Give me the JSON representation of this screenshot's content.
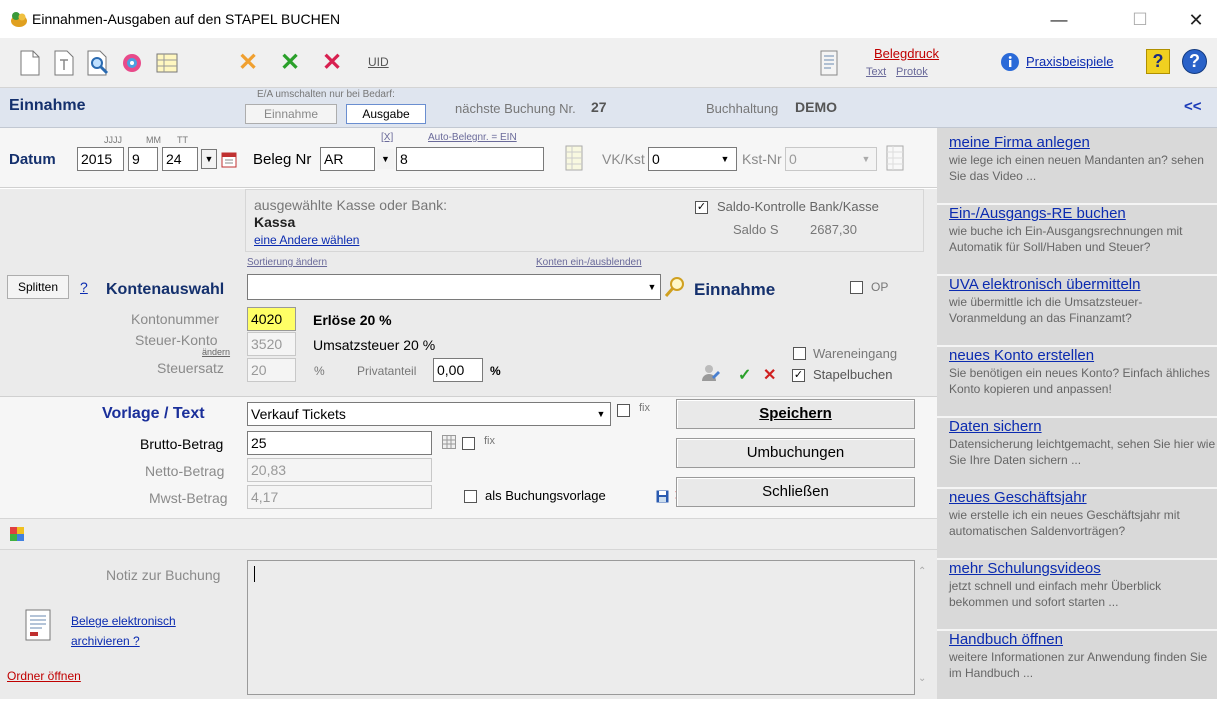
{
  "window": {
    "title": "Einnahmen-Ausgaben auf den STAPEL BUCHEN",
    "minimize": "—",
    "maximize": "☐",
    "close": "✕"
  },
  "toolbar": {
    "uid_label": "UID",
    "belegdruck": "Belegdruck",
    "text": "Text",
    "protok": "Protok",
    "praxisbeispiele": "Praxisbeispiele"
  },
  "header": {
    "title": "Einnahme",
    "switch_hint": "E/A umschalten nur bei Bedarf:",
    "btn_einnahme": "Einnahme",
    "btn_ausgabe": "Ausgabe",
    "next_booking_label": "nächste Buchung Nr.",
    "next_booking_value": "27",
    "buchhaltung_label": "Buchhaltung",
    "buchhaltung_value": "DEMO",
    "collapse": "<<"
  },
  "date_row": {
    "label": "Datum",
    "hint_year": "JJJJ",
    "hint_month": "MM",
    "hint_day": "TT",
    "year": "2015",
    "month": "9",
    "day": "24",
    "beleg_label": "Beleg Nr",
    "beleg_prefix": "AR",
    "beleg_number": "8",
    "auto_x": "[X]",
    "auto_beleg": "Auto-Belegnr. = EIN",
    "vk_label": "VK/Kst",
    "vk_value": "0",
    "kst_label": "Kst-Nr",
    "kst_value": "0"
  },
  "cash": {
    "heading": "ausgewählte Kasse oder Bank:",
    "name": "Kassa",
    "choose_other": "eine Andere wählen",
    "saldo_check_label": "Saldo-Kontrolle Bank/Kasse",
    "saldo_label": "Saldo S",
    "saldo_value": "2687,30"
  },
  "konten": {
    "sort_link": "Sortierung ändern",
    "toggle_link": "Konten ein-/ausblenden",
    "split_button": "Splitten",
    "help": "?",
    "label": "Kontenauswahl",
    "select_value": "",
    "type": "Einnahme",
    "op_label": "OP",
    "kontonummer_label": "Kontonummer",
    "kontonummer": "4020",
    "konto_name": "Erlöse 20 %",
    "steuer_label": "Steuer-Konto",
    "steuer_change": "ändern",
    "steuer_konto": "3520",
    "steuer_name": "Umsatzsteuer 20 %",
    "steuersatz_label": "Steuersatz",
    "steuersatz": "20",
    "percent": "%",
    "privat_label": "Privatanteil",
    "privat_value": "0,00",
    "wareneingang": "Wareneingang",
    "stapelbuchen": "Stapelbuchen"
  },
  "booking": {
    "vorlage_label": "Vorlage / Text",
    "vorlage_value": "Verkauf Tickets",
    "fix": "fix",
    "brutto_label": "Brutto-Betrag",
    "brutto": "25",
    "netto_label": "Netto-Betrag",
    "netto": "20,83",
    "mwst_label": "Mwst-Betrag",
    "mwst": "4,17",
    "vorlage_check": "als Buchungsvorlage",
    "save": "Speichern",
    "umbuchungen": "Umbuchungen",
    "close": "Schließen"
  },
  "notes": {
    "label": "Notiz zur Buchung",
    "value": "",
    "archive_link_1": "Belege elektronisch",
    "archive_link_2": "archivieren ?",
    "folder_link": "Ordner öffnen"
  },
  "sidebar": {
    "items": [
      {
        "title": "meine Firma anlegen",
        "desc": "wie lege ich einen neuen Mandanten an? sehen Sie das Video ..."
      },
      {
        "title": "Ein-/Ausgangs-RE buchen",
        "desc": "wie buche ich Ein-Ausgangsrechnungen mit Automatik für Soll/Haben und Steuer?"
      },
      {
        "title": "UVA elektronisch übermitteln",
        "desc": "wie übermittle ich die Umsatzsteuer-Voranmeldung an das Finanzamt?"
      },
      {
        "title": "neues Konto erstellen",
        "desc": "Sie benötigen ein neues Konto? Einfach ähliches Konto kopieren und anpassen!"
      },
      {
        "title": "Daten sichern",
        "desc": "Datensicherung leichtgemacht, sehen Sie hier wie Sie Ihre Daten sichern ..."
      },
      {
        "title": "neues Geschäftsjahr",
        "desc": "wie erstelle ich ein neues Geschäftsjahr mit automatischen Saldenvorträgen?"
      },
      {
        "title": "mehr Schulungsvideos",
        "desc": "jetzt schnell und einfach mehr Überblick bekommen und sofort starten ..."
      },
      {
        "title": "Handbuch öffnen",
        "desc": "weitere Informationen zur Anwendung finden Sie im Handbuch ..."
      }
    ]
  },
  "colors": {
    "accent_blue": "#14306d",
    "link_blue": "#0b2bb0",
    "sidebar_bg": "#d9d9d9",
    "highlight_yellow": "#ffff66",
    "danger_red": "#d02020",
    "ok_green": "#2aa02a"
  }
}
